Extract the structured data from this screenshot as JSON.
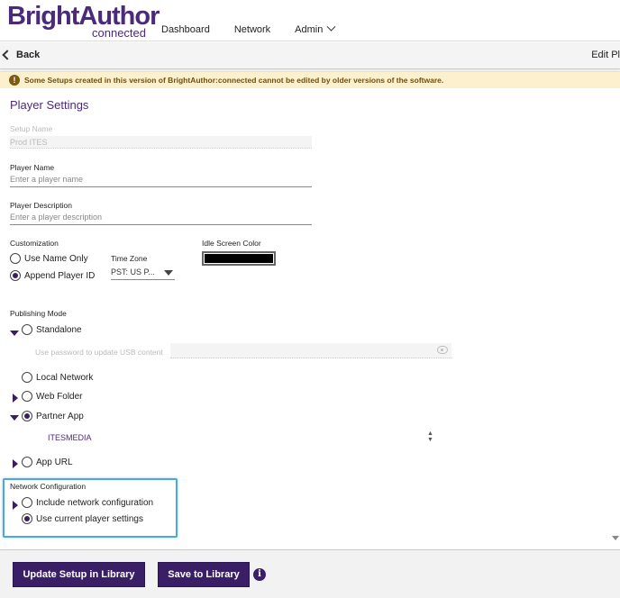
{
  "header": {
    "logo_main": "BrightAuthor",
    "logo_sub": "connected",
    "nav": [
      "Dashboard",
      "Network",
      "Admin"
    ]
  },
  "subbar": {
    "back_label": "Back",
    "right_label": "Edit Pl"
  },
  "banner": {
    "text": "Some Setups created in this version of BrightAuthor:connected cannot be edited by older versions of the software."
  },
  "form": {
    "title": "Player Settings",
    "setup_name_label": "Setup Name",
    "setup_name_value": "Prod ITES",
    "player_name_label": "Player Name",
    "player_name_placeholder": "Enter a player name",
    "player_desc_label": "Player Description",
    "player_desc_placeholder": "Enter a player description",
    "customization_label": "Customization",
    "use_name_only": "Use Name Only",
    "append_player_id": "Append Player ID",
    "timezone_label": "Time Zone",
    "timezone_value": "PST: US P...",
    "idle_color_label": "Idle Screen Color",
    "idle_color": "#000000",
    "publishing_label": "Publishing Mode",
    "standalone": "Standalone",
    "usb_password_label": "Use password to update USB content",
    "local_network": "Local Network",
    "web_folder": "Web Folder",
    "partner_app": "Partner App",
    "partner_value": "ITESMEDIA",
    "app_url": "App URL",
    "network_config_label": "Network Configuration",
    "include_network": "Include network configuration",
    "use_current": "Use current player settings"
  },
  "footer": {
    "update_button": "Update Setup in Library",
    "save_button": "Save to Library",
    "info_icon": "i"
  },
  "colors": {
    "brand": "#4b2a7b",
    "button": "#3b1f66",
    "highlight": "#4fa6d8",
    "banner": "#fdf1cd"
  }
}
